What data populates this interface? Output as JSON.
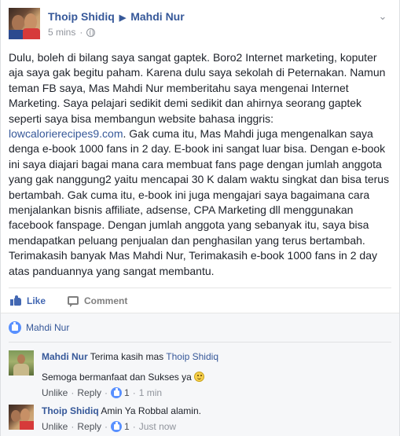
{
  "post": {
    "author": "Thoip Shidiq",
    "target": "Mahdi Nur",
    "time": "5 mins",
    "text_before_link": "Dulu, boleh di bilang saya sangat gaptek. Boro2 Internet marketing, koputer aja saya gak begitu paham. Karena dulu saya sekolah di Peternakan. Namun teman FB saya, Mas Mahdi Nur memberitahu saya mengenai Internet Marketing. Saya pelajari sedikit demi sedikit dan ahirnya seorang gaptek seperti saya bisa membangun website bahasa inggris: ",
    "link": "lowcalorierecipes9.com",
    "text_after_link": ". Gak cuma itu, Mas Mahdi juga mengenalkan saya denga e-book 1000 fans in 2 day. E-book ini sangat luar bisa. Dengan e-book ini saya diajari bagai mana cara membuat fans page dengan jumlah anggota yang gak nanggung2 yaitu mencapai 30 K dalam waktu singkat dan bisa terus bertambah. Gak cuma itu, e-book ini juga mengajari saya bagaimana cara menjalankan bisnis affiliate, adsense, CPA Marketing dll menggunakan facebook fanspage. Dengan jumlah anggota yang sebanyak itu, saya bisa mendapatkan peluang penjualan dan penghasilan yang terus bertambah. Terimakasih banyak Mas Mahdi Nur, Terimakasih e-book 1000 fans in 2 day atas panduannya yang sangat membantu."
  },
  "actions": {
    "like_label": "Like",
    "comment_label": "Comment"
  },
  "likes": {
    "names": "Mahdi Nur"
  },
  "comments": [
    {
      "author": "Mahdi Nur",
      "text": "Terima kasih mas",
      "tag": "Thoip Shidiq",
      "text2": "Semoga bermanfaat dan Sukses ya",
      "unlike": "Unlike",
      "reply": "Reply",
      "likes": "1",
      "time": "1 min"
    },
    {
      "author": "Thoip Shidiq",
      "text": "Amin Ya Robbal alamin.",
      "unlike": "Unlike",
      "reply": "Reply",
      "likes": "1",
      "time": "Just now"
    }
  ],
  "colors": {
    "link": "#365899",
    "like_blue": "#4267b2",
    "badge": "#5890ff"
  },
  "icons": [
    "globe-icon",
    "chevron-down-icon",
    "like-icon",
    "comment-icon",
    "like-badge-icon",
    "smile-emoji-icon"
  ]
}
